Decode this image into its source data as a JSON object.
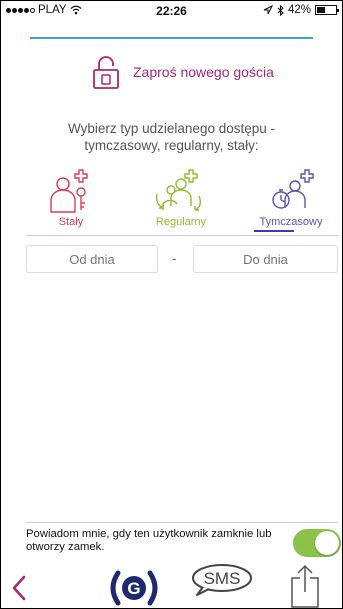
{
  "status_bar": {
    "carrier": "PLAY",
    "time": "22:26",
    "battery": "42%",
    "battery_level": 0.42
  },
  "header": {
    "icon": "padlock-icon",
    "title": "Zaproś nowego gościa"
  },
  "instructions": {
    "line1": "Wybierz typ udzielanego dostępu -",
    "line2": "tymczasowy, regularny, stały:"
  },
  "access_types": [
    {
      "label": "Stały",
      "icon": "person-key-add-icon",
      "color": "#e03b52"
    },
    {
      "label": "Regularny",
      "icon": "people-arrows-add-icon",
      "color": "#8fbf2c"
    },
    {
      "label": "Tymczasowy",
      "icon": "person-stopwatch-add-icon",
      "color": "#5656b8",
      "selected": true
    }
  ],
  "date_range": {
    "from_placeholder": "Od dnia",
    "separator": "-",
    "to_placeholder": "Do dnia"
  },
  "notify": {
    "text": "Powiadom mnie, gdy ten użytkownik zamknie lub otworzy zamek.",
    "enabled": true
  },
  "bottom_bar": {
    "back_icon": "chevron-left-icon",
    "logo_letter": "G",
    "sms_label": "SMS",
    "share_icon": "share-icon"
  },
  "colors": {
    "accent_blue": "#3e9fd3",
    "title_magenta": "#b0256e",
    "toggle_green": "#8bc34a",
    "logo_navy": "#1f2a6e",
    "back_magenta": "#b0256e"
  }
}
